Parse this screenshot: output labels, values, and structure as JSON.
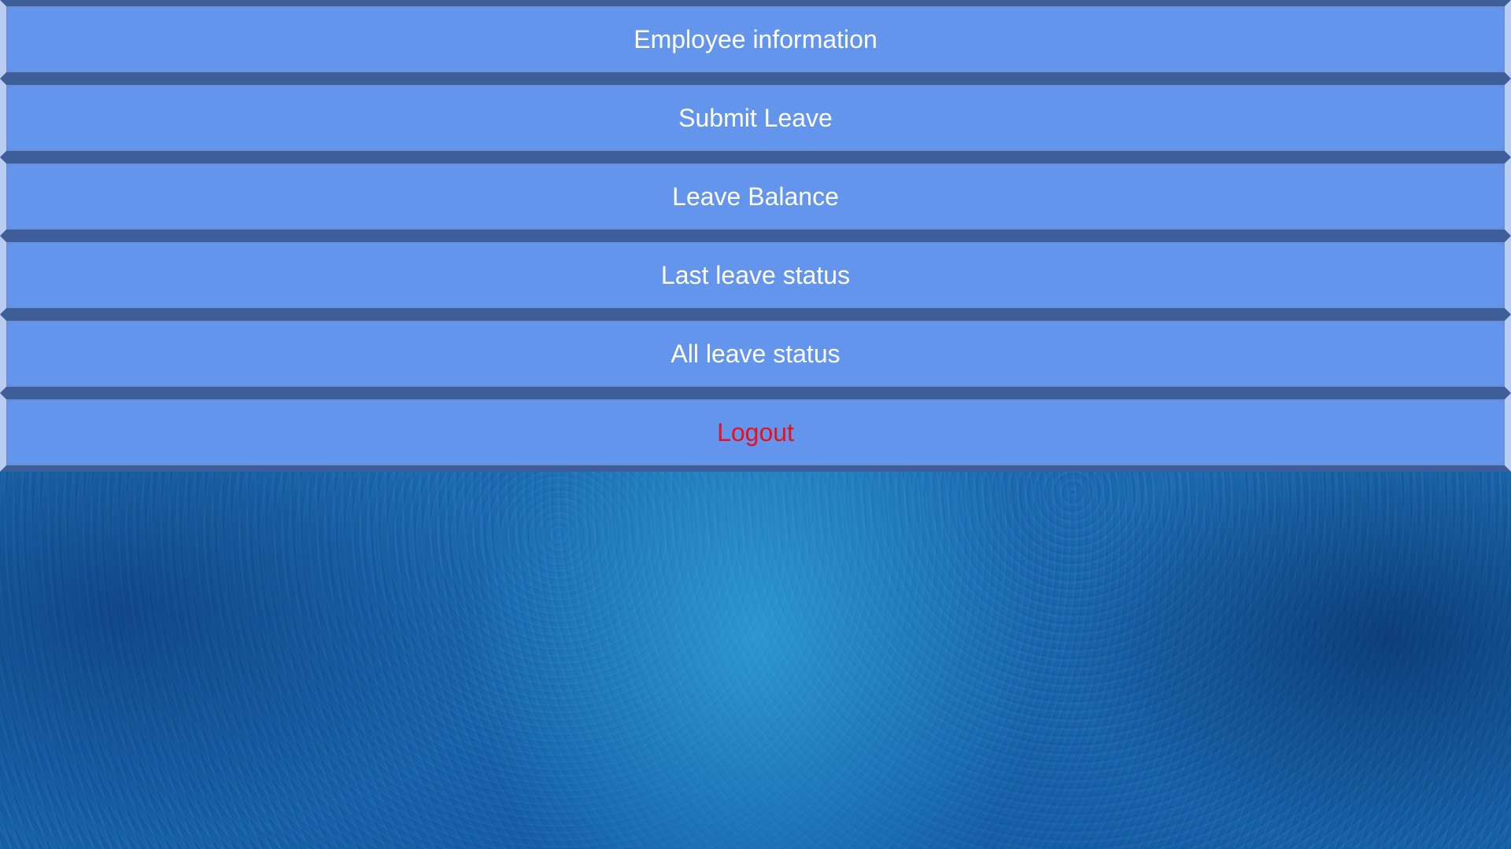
{
  "menu": {
    "items": [
      {
        "label": "Employee information",
        "color": "#ffffff"
      },
      {
        "label": "Submit Leave",
        "color": "#ffffff"
      },
      {
        "label": "Leave Balance",
        "color": "#ffffff"
      },
      {
        "label": "Last leave status",
        "color": "#ffffff"
      },
      {
        "label": "All leave status",
        "color": "#ffffff"
      },
      {
        "label": "Logout",
        "color": "#e8101c"
      }
    ]
  },
  "theme": {
    "button_color": "#6495ed",
    "background_color": "#1a6bb0"
  }
}
